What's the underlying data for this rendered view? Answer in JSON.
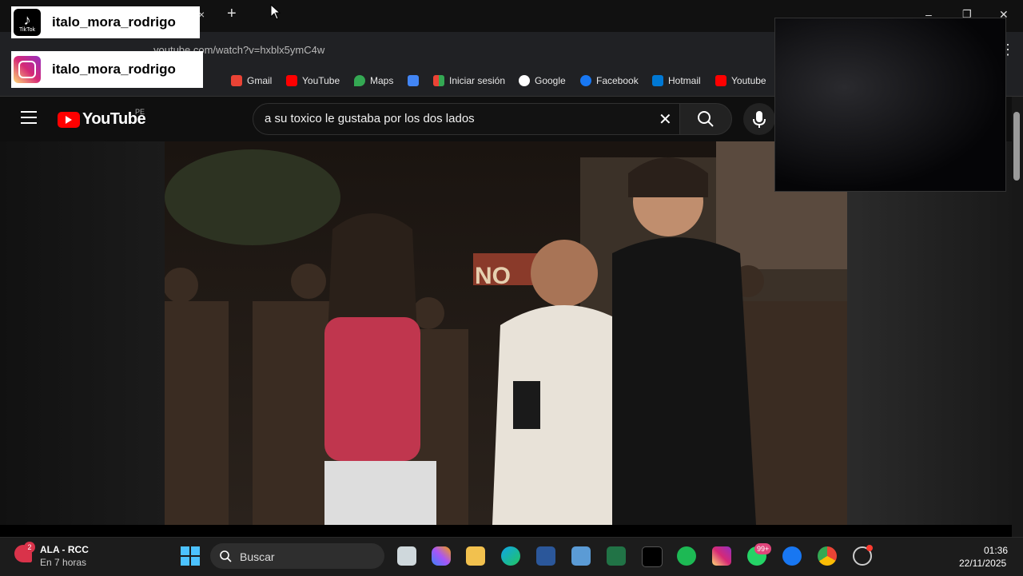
{
  "browser": {
    "tab_close": "×",
    "new_tab": "+",
    "url": "youtube.com/watch?v=hxblx5ymC4w",
    "window_controls": {
      "minimize": "–",
      "maximize": "❐",
      "close": "✕"
    },
    "bookmarks": [
      {
        "label": "Gmail",
        "color": "#ea4335"
      },
      {
        "label": "YouTube",
        "color": "#ff0000"
      },
      {
        "label": "Maps",
        "color": "#34a853"
      },
      {
        "label": "",
        "color": "#4285f4"
      },
      {
        "label": "Iniciar sesión",
        "color": "#fbbc05"
      },
      {
        "label": "Google",
        "color": "#ffffff"
      },
      {
        "label": "Facebook",
        "color": "#1877f2"
      },
      {
        "label": "Hotmail",
        "color": "#0078d4"
      },
      {
        "label": "Youtube",
        "color": "#ff0000"
      }
    ]
  },
  "overlay": {
    "tiktok": {
      "name": "italo_mora_rodrigo",
      "logo_text": "TikTok"
    },
    "instagram": {
      "name": "italo_mora_rodrigo"
    }
  },
  "youtube": {
    "logo_text": "YouTube",
    "region": "PE",
    "search_value": "a su toxico le gustaba por los dos lados"
  },
  "video": {
    "sign_text": "NO"
  },
  "taskbar": {
    "weather_badge": "2",
    "weather_title": "ALA - RCC",
    "weather_sub": "En 7 horas",
    "search_placeholder": "Buscar",
    "whatsapp_badge": "99+",
    "time": "01:36",
    "date": "22/11/2025"
  },
  "colors": {
    "accent_red": "#ff0000",
    "taskbar_bg": "#1c1c1c"
  }
}
